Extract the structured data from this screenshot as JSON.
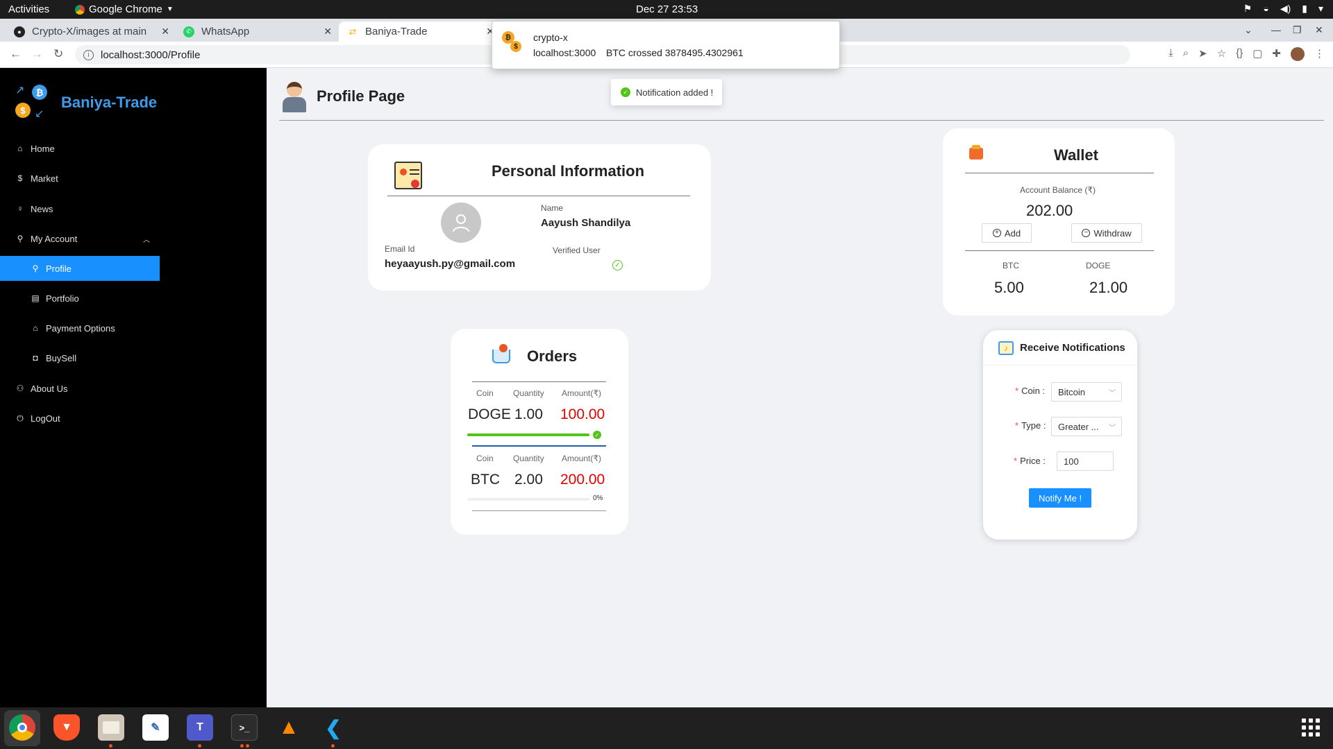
{
  "system": {
    "activities": "Activities",
    "app_menu": "Google Chrome",
    "clock": "Dec 27  23:53"
  },
  "browser": {
    "tabs": [
      {
        "title": "Crypto-X/images at main",
        "icon": "github-icon"
      },
      {
        "title": "WhatsApp",
        "icon": "whatsapp-icon"
      },
      {
        "title": "Baniya-Trade",
        "icon": "baniya-trade-icon",
        "active": true
      }
    ],
    "url": "localhost:3000/Profile"
  },
  "os_notification": {
    "title": "crypto-x",
    "origin": "localhost:3000",
    "message": "BTC crossed 3878495.4302961"
  },
  "toast": {
    "message": "Notification added !"
  },
  "sidebar": {
    "brand": "Baniya-Trade",
    "items": [
      {
        "label": "Home",
        "icon": "home-icon"
      },
      {
        "label": "Market",
        "icon": "dollar-icon"
      },
      {
        "label": "News",
        "icon": "bulb-icon"
      },
      {
        "label": "My Account",
        "icon": "user-icon",
        "expanded": true
      },
      {
        "label": "Profile",
        "icon": "user-icon",
        "active": true
      },
      {
        "label": "Portfolio",
        "icon": "portfolio-icon"
      },
      {
        "label": "Payment Options",
        "icon": "bank-icon"
      },
      {
        "label": "BuySell",
        "icon": "shopping-icon"
      },
      {
        "label": "About Us",
        "icon": "team-icon"
      },
      {
        "label": "LogOut",
        "icon": "logout-icon"
      }
    ]
  },
  "page": {
    "title": "Profile Page"
  },
  "personal": {
    "title": "Personal Information",
    "name_label": "Name",
    "name": "Aayush Shandilya",
    "email_label": "Email Id",
    "email": "heyaayush.py@gmail.com",
    "verified_label": "Verified User"
  },
  "wallet": {
    "title": "Wallet",
    "balance_label": "Account Balance (₹)",
    "balance": "202.00",
    "add_label": "Add",
    "withdraw_label": "Withdraw",
    "holdings": [
      {
        "coin": "BTC",
        "amount": "5.00"
      },
      {
        "coin": "DOGE",
        "amount": "21.00"
      }
    ]
  },
  "orders": {
    "title": "Orders",
    "headers": [
      "Coin",
      "Quantity",
      "Amount(₹)"
    ],
    "rows": [
      {
        "coin": "DOGE",
        "quantity": "1.00",
        "amount": "100.00",
        "progress": 1.0,
        "status": "complete"
      },
      {
        "coin": "BTC",
        "quantity": "2.00",
        "amount": "200.00",
        "progress": 0.0,
        "progress_label": "0%"
      }
    ]
  },
  "notifications": {
    "title": "Receive Notifications",
    "coin_label": "Coin",
    "coin_value": "Bitcoin",
    "type_label": "Type",
    "type_value": "Greater ...",
    "price_label": "Price",
    "price_value": "100",
    "submit_label": "Notify Me !"
  },
  "colors": {
    "accent": "#1890ff",
    "brand": "#3d9be9",
    "success": "#52c41a",
    "danger": "#e50000",
    "sidebar_bg": "#000000"
  }
}
